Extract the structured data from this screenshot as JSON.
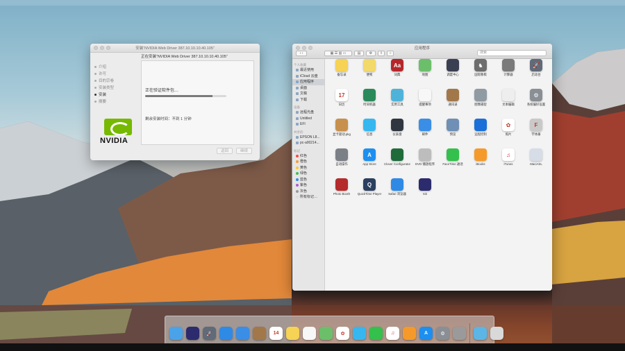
{
  "installer": {
    "window_title": "安装“NVIDIA Web Driver 387.10.10.10.40.105”",
    "header": "正在安装“NVIDIA Web Driver 387.10.10.10.40.105”",
    "steps": [
      {
        "label": "介绍",
        "active": false
      },
      {
        "label": "许可",
        "active": false
      },
      {
        "label": "目的宗卷",
        "active": false
      },
      {
        "label": "安装类型",
        "active": false
      },
      {
        "label": "安装",
        "active": true
      },
      {
        "label": "摘要",
        "active": false
      }
    ],
    "status": "正在验证软件包…",
    "progress": 0.83,
    "time_remaining": "剩余安装时间：不到 1 分钟",
    "logo_text": "NVIDIA",
    "back_button": "返回",
    "continue_button": "继续"
  },
  "finder": {
    "title": "应用程序",
    "search_placeholder": "搜索",
    "sidebar": {
      "favorites_heading": "个人收藏",
      "favorites": [
        {
          "label": "最近使用",
          "selected": false
        },
        {
          "label": "iCloud 云盘",
          "selected": false
        },
        {
          "label": "应用程序",
          "selected": true
        },
        {
          "label": "桌面",
          "selected": false
        },
        {
          "label": "文稿",
          "selected": false
        },
        {
          "label": "下载",
          "selected": false
        }
      ],
      "devices_heading": "设备",
      "devices": [
        {
          "label": "远程光盘"
        },
        {
          "label": "Untitled"
        },
        {
          "label": "EFI"
        }
      ],
      "shared_heading": "共享的",
      "shared": [
        {
          "label": "EPSON L8..."
        },
        {
          "label": "pc-a00214..."
        }
      ],
      "tags_heading": "标记",
      "tags": [
        {
          "label": "红色",
          "color": "#ff4a3d"
        },
        {
          "label": "橙色",
          "color": "#ff9a2e"
        },
        {
          "label": "黄色",
          "color": "#f7cf2b"
        },
        {
          "label": "绿色",
          "color": "#3fc24e"
        },
        {
          "label": "蓝色",
          "color": "#2f8cf5"
        },
        {
          "label": "紫色",
          "color": "#b25ad6"
        },
        {
          "label": "灰色",
          "color": "#9a9a9a"
        },
        {
          "label": "所有标记…",
          "color": "#dddddd"
        }
      ]
    },
    "apps": [
      {
        "label": "备忘录",
        "icon": "notes-icon",
        "color": "#f6d255",
        "glyph": ""
      },
      {
        "label": "便笺",
        "icon": "stickies-icon",
        "color": "#f3d86a",
        "glyph": ""
      },
      {
        "label": "词典",
        "icon": "dictionary-icon",
        "color": "#b5262a",
        "glyph": "Aa"
      },
      {
        "label": "地图",
        "icon": "maps-icon",
        "color": "#6cbf6a",
        "glyph": ""
      },
      {
        "label": "调度中心",
        "icon": "mission-control-icon",
        "color": "#3b3f52",
        "glyph": ""
      },
      {
        "label": "国际象棋",
        "icon": "chess-icon",
        "color": "#6d6d6d",
        "glyph": "♞"
      },
      {
        "label": "计算器",
        "icon": "calculator-icon",
        "color": "#7a7a7a",
        "glyph": ""
      },
      {
        "label": "启动台",
        "icon": "launchpad-icon",
        "color": "#606a79",
        "glyph": "🚀"
      },
      {
        "label": "日历",
        "icon": "calendar-icon",
        "color": "#ffffff",
        "glyph": "17"
      },
      {
        "label": "时间机器",
        "icon": "time-machine-icon",
        "color": "#2b8a5a",
        "glyph": ""
      },
      {
        "label": "实用工具",
        "icon": "utilities-icon",
        "color": "#4fb3d9",
        "glyph": ""
      },
      {
        "label": "提醒事项",
        "icon": "reminders-icon",
        "color": "#f7f7f7",
        "glyph": ""
      },
      {
        "label": "通讯录",
        "icon": "contacts-icon",
        "color": "#a2784a",
        "glyph": ""
      },
      {
        "label": "图像捕捉",
        "icon": "image-capture-icon",
        "color": "#8f9aa3",
        "glyph": ""
      },
      {
        "label": "文本编辑",
        "icon": "textedit-icon",
        "color": "#eeeeee",
        "glyph": ""
      },
      {
        "label": "系统偏好设置",
        "icon": "system-preferences-icon",
        "color": "#8a8f96",
        "glyph": "⚙"
      },
      {
        "label": "显卡驱动.pkg",
        "icon": "package-icon",
        "color": "#c7904c",
        "glyph": ""
      },
      {
        "label": "信息",
        "icon": "messages-icon",
        "color": "#37b7f0",
        "glyph": ""
      },
      {
        "label": "仪表盘",
        "icon": "dashboard-icon",
        "color": "#2f3640",
        "glyph": ""
      },
      {
        "label": "邮件",
        "icon": "mail-icon",
        "color": "#3a8ee6",
        "glyph": ""
      },
      {
        "label": "预览",
        "icon": "preview-icon",
        "color": "#6f8fb5",
        "glyph": ""
      },
      {
        "label": "远程控制",
        "icon": "teamviewer-icon",
        "color": "#1b6fd8",
        "glyph": ""
      },
      {
        "label": "照片",
        "icon": "photos-icon",
        "color": "#ffffff",
        "glyph": "✿"
      },
      {
        "label": "字体册",
        "icon": "font-book-icon",
        "color": "#c9c9c9",
        "glyph": "F"
      },
      {
        "label": "自动操作",
        "icon": "automator-icon",
        "color": "#7b7f86",
        "glyph": ""
      },
      {
        "label": "App Store",
        "icon": "app-store-icon",
        "color": "#1c8ff0",
        "glyph": "A"
      },
      {
        "label": "Clover Configurator",
        "icon": "clover-configurator-icon",
        "color": "#1f6b3a",
        "glyph": ""
      },
      {
        "label": "DVD 播放程序",
        "icon": "dvd-player-icon",
        "color": "#bdbdbd",
        "glyph": ""
      },
      {
        "label": "FaceTime 通话",
        "icon": "facetime-icon",
        "color": "#34c04c",
        "glyph": ""
      },
      {
        "label": "iBooks",
        "icon": "ibooks-icon",
        "color": "#f59a2a",
        "glyph": ""
      },
      {
        "label": "iTunes",
        "icon": "itunes-icon",
        "color": "#ffffff",
        "glyph": "♫"
      },
      {
        "label": "MaciASL",
        "icon": "maciasl-icon",
        "color": "#d7dde6",
        "glyph": ""
      },
      {
        "label": "Photo Booth",
        "icon": "photo-booth-icon",
        "color": "#b52b2b",
        "glyph": ""
      },
      {
        "label": "QuickTime Player",
        "icon": "quicktime-icon",
        "color": "#2b3f5e",
        "glyph": "Q"
      },
      {
        "label": "Safari 浏览器",
        "icon": "safari-icon",
        "color": "#2f8ae5",
        "glyph": ""
      },
      {
        "label": "Siri",
        "icon": "siri-icon",
        "color": "#2b2b6e",
        "glyph": ""
      }
    ]
  },
  "dock": {
    "items": [
      {
        "icon": "finder-icon",
        "color": "#4aa3e8",
        "glyph": ""
      },
      {
        "icon": "siri-icon",
        "color": "#2b2b6e",
        "glyph": ""
      },
      {
        "icon": "launchpad-icon",
        "color": "#606a79",
        "glyph": "🚀"
      },
      {
        "icon": "safari-icon",
        "color": "#2f8ae5",
        "glyph": ""
      },
      {
        "icon": "mail-icon",
        "color": "#3a8ee6",
        "glyph": ""
      },
      {
        "icon": "contacts-icon",
        "color": "#a2784a",
        "glyph": ""
      },
      {
        "icon": "calendar-icon",
        "color": "#ffffff",
        "glyph": "14"
      },
      {
        "icon": "notes-icon",
        "color": "#f6d255",
        "glyph": ""
      },
      {
        "icon": "reminders-icon",
        "color": "#f7f7f7",
        "glyph": ""
      },
      {
        "icon": "maps-icon",
        "color": "#6cbf6a",
        "glyph": ""
      },
      {
        "icon": "photos-icon",
        "color": "#ffffff",
        "glyph": "✿"
      },
      {
        "icon": "messages-icon",
        "color": "#37b7f0",
        "glyph": ""
      },
      {
        "icon": "facetime-icon",
        "color": "#34c04c",
        "glyph": ""
      },
      {
        "icon": "itunes-icon",
        "color": "#ffffff",
        "glyph": "♫"
      },
      {
        "icon": "ibooks-icon",
        "color": "#f59a2a",
        "glyph": ""
      },
      {
        "icon": "app-store-icon",
        "color": "#1c8ff0",
        "glyph": "A"
      },
      {
        "icon": "system-preferences-icon",
        "color": "#8a8f96",
        "glyph": "⚙"
      },
      {
        "icon": "package-icon",
        "color": "#9a9a9a",
        "glyph": ""
      },
      {
        "icon": "downloads-folder-icon",
        "color": "#5bb6e6",
        "glyph": ""
      },
      {
        "icon": "trash-icon",
        "color": "#d9d9d9",
        "glyph": ""
      }
    ]
  }
}
